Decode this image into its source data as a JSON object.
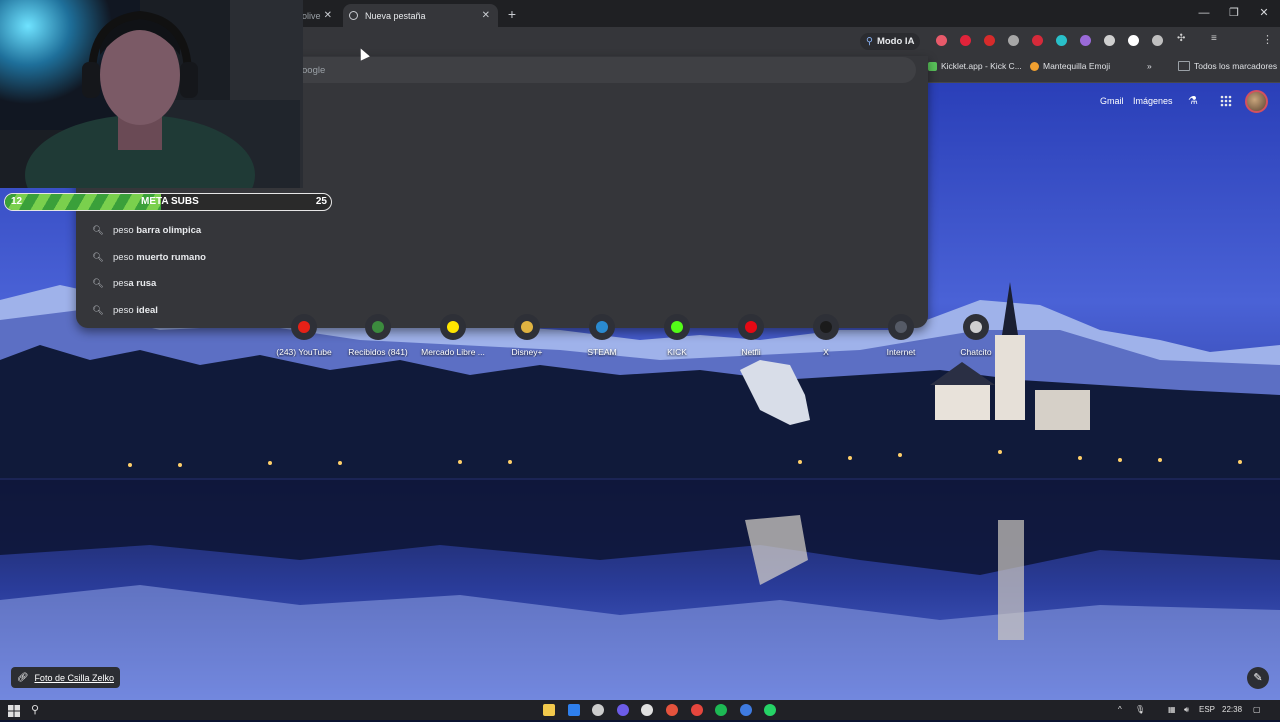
{
  "tabs": [
    {
      "label": "olive",
      "active": false
    },
    {
      "label": "Nueva pestaña",
      "active": true
    }
  ],
  "toolbar": {
    "mode_ia_label": "Modo IA",
    "extension_colors": [
      "#e85a6a",
      "#e0233a",
      "#d72b2b",
      "#a7a7a7",
      "#d62a3a",
      "#29c0c9",
      "#9a6ad8",
      "#cfcfcf",
      "#ffffff",
      "#bfbfbf",
      "#cfcfcf",
      "#cfcfcf",
      "#888888",
      "#cfcfcf"
    ]
  },
  "bookmarks": [
    {
      "label": "Kicklet.app - Kick C...",
      "color": "#59c25a"
    },
    {
      "label": "Mantequilla Emoji",
      "color": "#f0a030"
    },
    {
      "label": "Todos los marcadores",
      "color": "#9aa0a6"
    }
  ],
  "omnibox": {
    "text": "oogle",
    "suggestions": [
      {
        "prefix": "peso ",
        "bold": "barra olimpica"
      },
      {
        "prefix": "peso ",
        "bold": "muerto rumano"
      },
      {
        "prefix": "pes",
        "bold": "a rusa"
      },
      {
        "prefix": "peso ",
        "bold": "ideal"
      }
    ]
  },
  "webcam": {
    "meta_label": "META SUBS",
    "current": "12",
    "goal": "25",
    "progress_fraction": 0.48
  },
  "google_header": {
    "gmail": "Gmail",
    "images": "Imágenes"
  },
  "shortcuts": [
    {
      "label": "(243) YouTube",
      "color": "#e62117"
    },
    {
      "label": "Recibidos (841)",
      "color": "#3c8b3e"
    },
    {
      "label": "Mercado Libre ...",
      "color": "#ffe600"
    },
    {
      "label": "Disney+",
      "color": "#e0b341"
    },
    {
      "label": "STEAM",
      "color": "#2a8ad0"
    },
    {
      "label": "KICK",
      "color": "#53fc18"
    },
    {
      "label": "Netfli",
      "color": "#e50914"
    },
    {
      "label": "X",
      "color": "#1b1b1b"
    },
    {
      "label": "Internet",
      "color": "#555a66"
    },
    {
      "label": "Chatcito",
      "color": "#d0d0d0"
    }
  ],
  "credit": {
    "label": "Foto de Csilla Zelko"
  },
  "taskbar": {
    "language": "ESP",
    "time": "22:38",
    "app_colors": [
      "#f2c94c",
      "#2f80ed",
      "#cccccc",
      "#6c5ce7",
      "#e0e0e0",
      "#e5533d",
      "#e5463d",
      "#1db954",
      "#3f7be0",
      "#25d366"
    ]
  }
}
